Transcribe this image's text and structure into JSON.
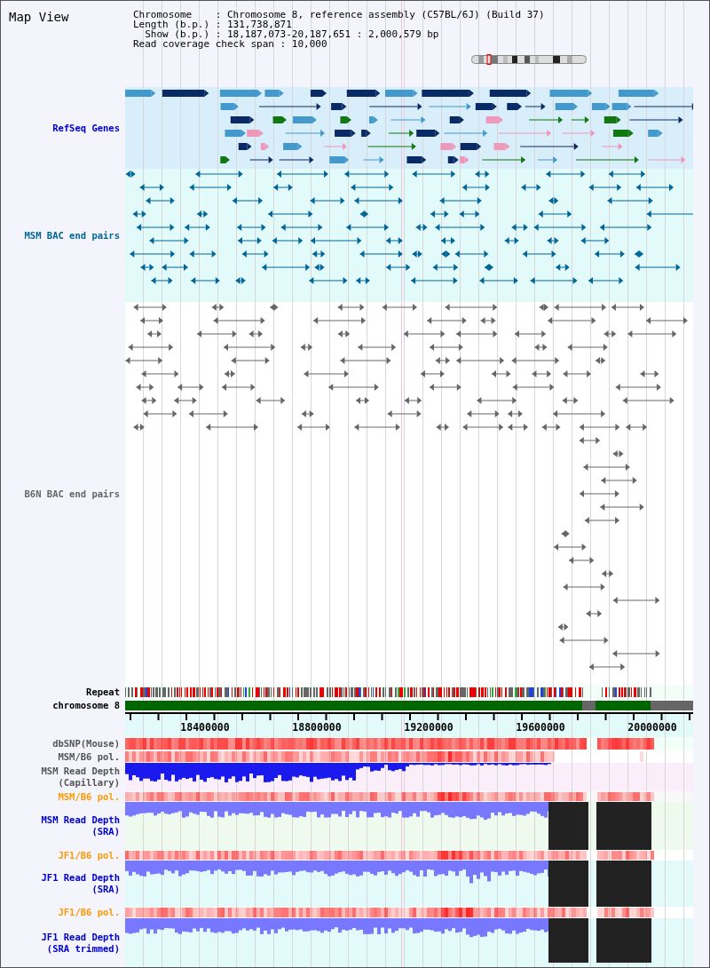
{
  "title": "Map View",
  "info_lines": [
    "Chromosome    : Chromosome 8, reference assembly (C57BL/6J) (Build 37)",
    "Length (b.p.) : 131,738,871",
    "  Show (b.p.) : 18,187,073-20,187,651 : 2,000,579 bp",
    "Read coverage check span : 10,000"
  ],
  "tracks": [
    {
      "kind": "genes",
      "label": "RefSeq Genes",
      "color": "#0000cc"
    },
    {
      "kind": "pairs",
      "label": "MSM BAC end pairs",
      "color": "#006699"
    },
    {
      "kind": "pairs",
      "label": "B6N BAC end pairs",
      "color": "#666666"
    },
    {
      "kind": "repeat",
      "label": "Repeat",
      "color": "#000000"
    },
    {
      "kind": "chromosome",
      "label": "chromosome 8",
      "color": "#000000"
    },
    {
      "kind": "axis",
      "ticks": [
        "18400000",
        "18800000",
        "19200000",
        "19600000",
        "20000000"
      ]
    },
    {
      "kind": "heatmap",
      "label": "dbSNP(Mouse)",
      "color": "#555555"
    },
    {
      "kind": "heatmap",
      "label": "MSM/B6 pol.",
      "color": "#555555"
    },
    {
      "kind": "depth",
      "label": "MSM Read Depth\n(Capillary)",
      "color": "#555555"
    },
    {
      "kind": "heatmap",
      "label": "MSM/B6 pol.",
      "color": "#ff9900"
    },
    {
      "kind": "depth",
      "label": "MSM Read Depth\n(SRA)",
      "color": "#0000cc"
    },
    {
      "kind": "heatmap",
      "label": "JF1/B6 pol.",
      "color": "#ff9900"
    },
    {
      "kind": "depth",
      "label": "JF1 Read Depth\n(SRA)",
      "color": "#0000cc"
    },
    {
      "kind": "heatmap",
      "label": "JF1/B6 pol.",
      "color": "#ff9900"
    },
    {
      "kind": "depth",
      "label": "JF1 Read Depth\n(SRA trimmed)",
      "color": "#0000cc"
    }
  ]
}
